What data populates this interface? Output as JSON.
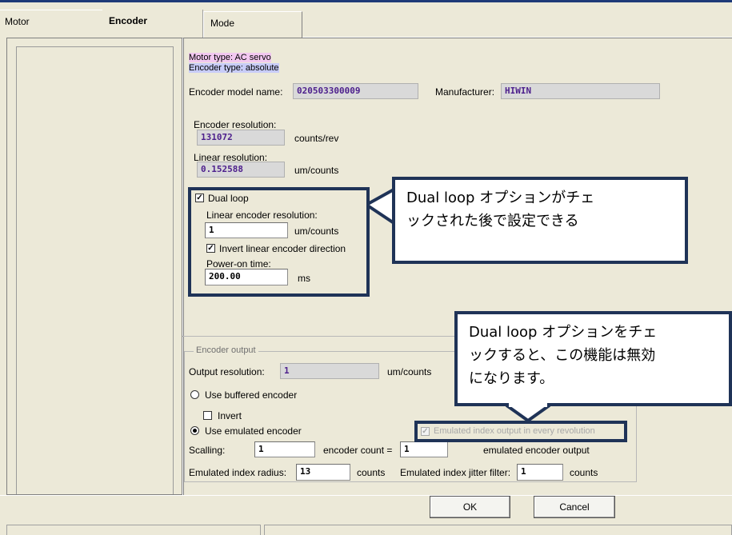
{
  "tabs": [
    "Motor",
    "Encoder",
    "Mode"
  ],
  "motor_info": {
    "motor_type": "Motor type: AC servo",
    "encoder_type": "Encoder type: absolute"
  },
  "encoder": {
    "model_label": "Encoder model name:",
    "model_value": "020503300009",
    "manufacturer_label": "Manufacturer:",
    "manufacturer_value": "HIWIN",
    "resolution_label": "Encoder resolution:",
    "resolution_value": "131072",
    "resolution_unit": "counts/rev",
    "linear_label": "Linear resolution:",
    "linear_value": "0.152588",
    "linear_unit": "um/counts"
  },
  "dual_loop": {
    "checkbox_label": "Dual loop",
    "checked": true,
    "linear_enc_res_label": "Linear encoder resolution:",
    "linear_enc_res_value": "1",
    "linear_enc_res_unit": "um/counts",
    "invert_label": "Invert linear encoder direction",
    "invert_checked": true,
    "power_on_label": "Power-on time:",
    "power_on_value": "200.00",
    "power_on_unit": "ms"
  },
  "callouts": {
    "callout1": [
      "Dual loop オプションがチェ",
      "ックされた後で設定できる"
    ],
    "callout2": [
      "Dual loop オプションをチェ",
      "ックすると、この機能は無効",
      "になります。"
    ]
  },
  "encoder_output": {
    "group_title": "Encoder output",
    "output_res_label": "Output resolution:",
    "output_res_value": "1",
    "output_res_unit": "um/counts",
    "buffered_label": "Use buffered encoder",
    "invert_label": "Invert",
    "emulated_label": "Use emulated encoder",
    "emulated_selected": true,
    "emulated_index_label": "Emulated index output in every revolution",
    "scaling_label": "Scalling:",
    "scaling_value": "1",
    "encoder_count_label": "encoder count =",
    "encoder_count_value": "1",
    "emulated_output_label": "emulated encoder output",
    "index_radius_label": "Emulated index radius:",
    "index_radius_value": "13",
    "index_radius_unit": "counts",
    "jitter_label": "Emulated index jitter filter:",
    "jitter_value": "1",
    "jitter_unit": "counts"
  },
  "buttons": {
    "ok": "OK",
    "cancel": "Cancel"
  },
  "colors": {
    "callout_border": "#1f3357",
    "readonly_text": "#4c1e8c",
    "motor_type_bg": "#f2c8f0",
    "encoder_type_bg": "#c8ccf8"
  }
}
